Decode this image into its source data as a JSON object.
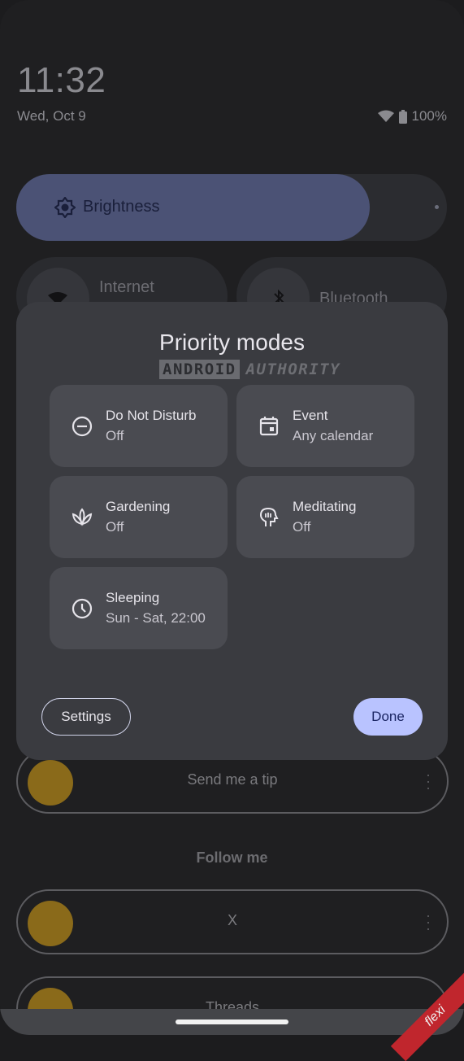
{
  "status": {
    "time": "11:32",
    "date": "Wed, Oct 9",
    "battery": "100%"
  },
  "brightness": {
    "label": "Brightness",
    "level": 0.82
  },
  "quick_tiles": [
    {
      "label": "Internet"
    },
    {
      "label": "Bluetooth"
    }
  ],
  "dialog": {
    "title": "Priority modes",
    "watermark_a": "ANDROID",
    "watermark_b": "AUTHORITY",
    "modes": [
      {
        "name": "Do Not Disturb",
        "status": "Off",
        "icon": "do-not-disturb-icon"
      },
      {
        "name": "Event",
        "status": "Any calendar",
        "icon": "calendar-icon"
      },
      {
        "name": "Gardening",
        "status": "Off",
        "icon": "lotus-icon"
      },
      {
        "name": "Meditating",
        "status": "Off",
        "icon": "head-icon"
      },
      {
        "name": "Sleeping",
        "status": "Sun - Sat, 22:00",
        "icon": "clock-icon"
      }
    ],
    "settings_label": "Settings",
    "done_label": "Done"
  },
  "background_list": {
    "tip_label": "Send me a tip",
    "follow_heading": "Follow me",
    "x_label": "X",
    "threads_label": "Threads"
  },
  "corner_badge": "flexi"
}
